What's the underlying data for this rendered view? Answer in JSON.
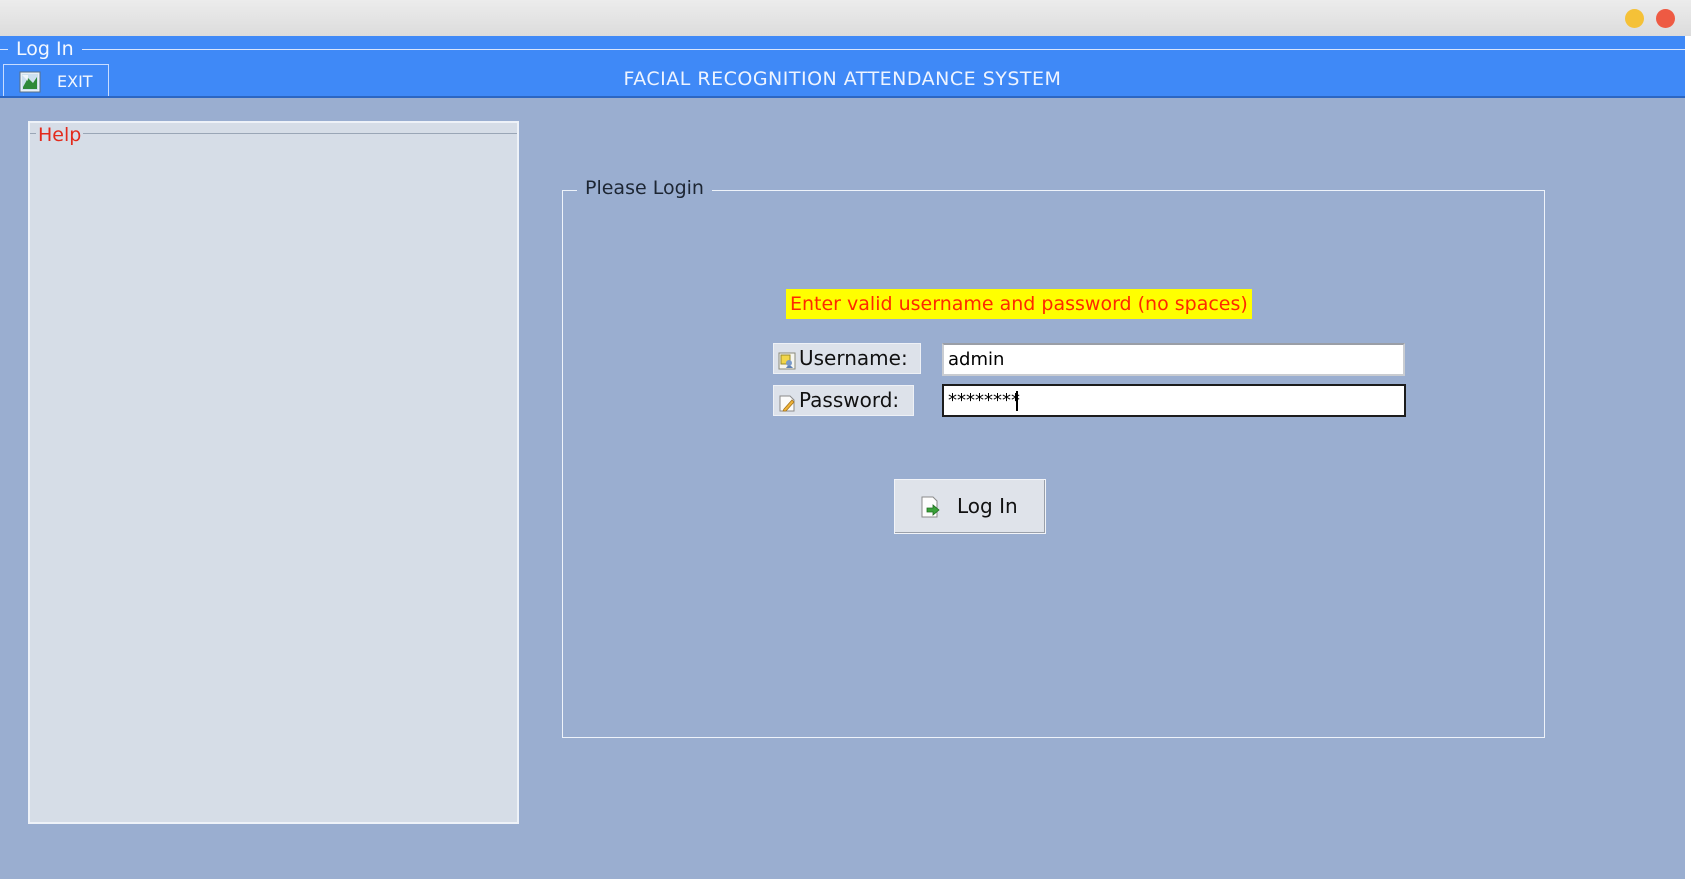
{
  "window": {
    "title": "Log In",
    "controls": {
      "minimize_color": "#f5c137",
      "close_color": "#ee5a43"
    }
  },
  "header": {
    "exit_label": "EXIT",
    "exit_icon": "exit-door-icon",
    "app_title": "FACIAL RECOGNITION ATTENDANCE SYSTEM"
  },
  "help": {
    "legend": "Help"
  },
  "login": {
    "legend": "Please Login",
    "message": "Enter valid username and password (no spaces)",
    "username_label": "Username:",
    "username_icon": "user-icon",
    "username_value": "admin",
    "password_label": "Password:",
    "password_icon": "edit-icon",
    "password_value": "********",
    "button_label": "Log In",
    "button_icon": "login-arrow-icon"
  },
  "colors": {
    "header_blue": "#3f89f7",
    "background": "#9aaed0",
    "message_bg": "#ffff00",
    "message_text": "#ff2800",
    "help_legend": "#e32a1c"
  }
}
